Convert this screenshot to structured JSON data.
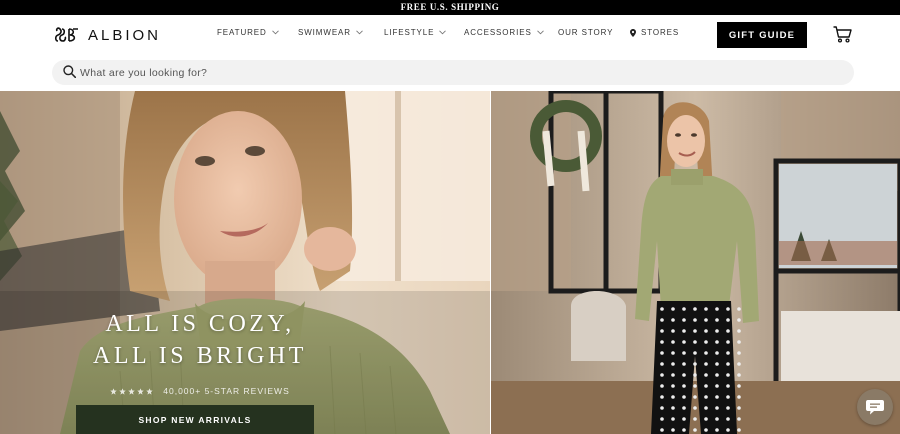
{
  "announcement": "FREE U.S. SHIPPING",
  "brand": {
    "name": "ALBION",
    "logo_icon": "albion-monogram-icon"
  },
  "nav": [
    {
      "label": "FEATURED",
      "has_dropdown": true
    },
    {
      "label": "SWIMWEAR",
      "has_dropdown": true
    },
    {
      "label": "LIFESTYLE",
      "has_dropdown": true
    },
    {
      "label": "ACCESSORIES",
      "has_dropdown": true
    },
    {
      "label": "OUR STORY",
      "has_dropdown": false
    },
    {
      "label": "STORES",
      "has_dropdown": false,
      "icon": "location-pin-icon"
    }
  ],
  "gift_button": "GIFT GUIDE",
  "cart_icon": "shopping-cart-icon",
  "search": {
    "placeholder": "What are you looking for?",
    "icon": "search-icon"
  },
  "hero": {
    "headline_line1": "ALL IS COZY,",
    "headline_line2": "ALL IS BRIGHT",
    "rating_stars": 5,
    "reviews_text": "40,000+ 5-STAR REVIEWS",
    "cta": "SHOP NEW ARRIVALS"
  },
  "chat_icon": "chat-bubble-icon",
  "colors": {
    "announcement_bg": "#000000",
    "cta_bg": "#25321f",
    "sweater_green": "#a7ac75",
    "chat_bg": "#8a7a66"
  }
}
